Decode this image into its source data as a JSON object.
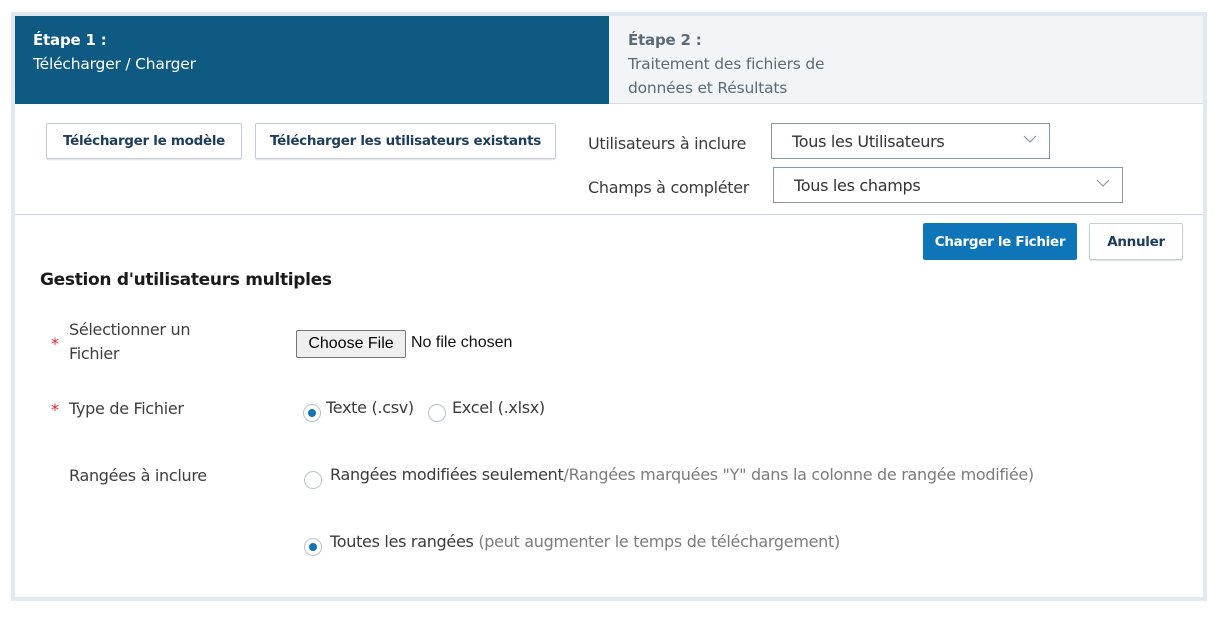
{
  "steps": [
    {
      "title": "Étape 1 :",
      "subtitle": "Télécharger / Charger",
      "active": true
    },
    {
      "title": "Étape 2 :",
      "subtitle": "Traitement des fichiers de données et Résultats",
      "active": false
    }
  ],
  "toolbar": {
    "download_template_label": "Télécharger le modèle",
    "download_existing_label": "Télécharger les utilisateurs existants",
    "users_filter": {
      "label": "Utilisateurs à inclure",
      "value": "Tous les Utilisateurs"
    },
    "fields_filter": {
      "label": "Champs à compléter",
      "value": "Tous les champs"
    }
  },
  "actions": {
    "upload_label": "Charger le Fichier",
    "cancel_label": "Annuler"
  },
  "form": {
    "title": "Gestion d'utilisateurs multiples",
    "required_marker": "*",
    "file": {
      "label": "Sélectionner un Fichier",
      "button_label": "Choose File",
      "status": "No file chosen"
    },
    "file_type": {
      "label": "Type de Fichier",
      "options": [
        {
          "label": "Texte (.csv)",
          "checked": true
        },
        {
          "label": "Excel (.xlsx)",
          "checked": false
        }
      ]
    },
    "rows": {
      "label": "Rangées à inclure",
      "options": [
        {
          "label": "Rangées modifiées seulement",
          "hint": "/Rangées marquées \"Y\" dans la colonne de rangée modifiée)",
          "checked": false
        },
        {
          "label": "Toutes les rangées",
          "hint": "(peut augmenter le temps de téléchargement)",
          "checked": true
        }
      ]
    }
  },
  "colors": {
    "step_active_bg": "#0e5a82",
    "step_inactive_bg": "#f1f5f8",
    "primary": "#0e76b8",
    "required": "#e0202c"
  }
}
